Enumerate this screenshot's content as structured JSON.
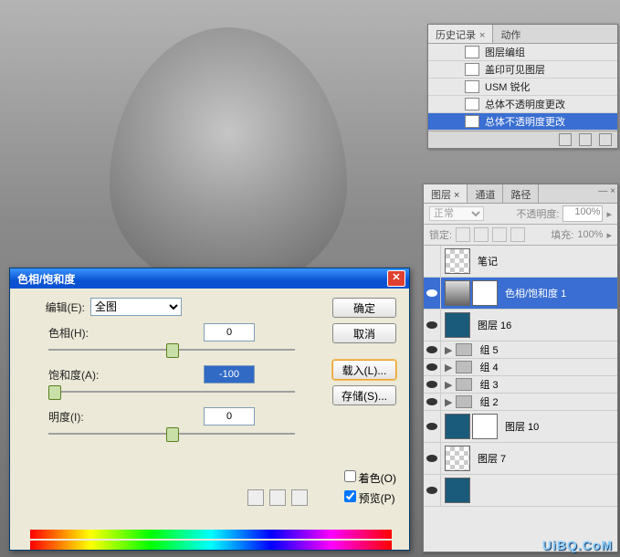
{
  "history": {
    "tabs": {
      "history": "历史记录",
      "actions": "动作"
    },
    "items": [
      {
        "label": "图层编组"
      },
      {
        "label": "盖印可见图层"
      },
      {
        "label": "USM 锐化"
      },
      {
        "label": "总体不透明度更改"
      },
      {
        "label": "总体不透明度更改",
        "selected": true
      }
    ]
  },
  "layers": {
    "tabs": {
      "layers": "图层",
      "channels": "通道",
      "paths": "路径"
    },
    "blend_mode": "正常",
    "opacity_label": "不透明度:",
    "opacity_value": "100%",
    "lock_label": "锁定:",
    "fill_label": "填充:",
    "fill_value": "100%",
    "items": [
      {
        "name": "笔记",
        "thumb": "checker",
        "visible": false
      },
      {
        "name": "色相/饱和度 1",
        "thumb": "grad",
        "mask": true,
        "selected": true,
        "visible": true
      },
      {
        "name": "图层 16",
        "thumb": "blue",
        "visible": true
      },
      {
        "name": "组 5",
        "type": "group",
        "visible": true
      },
      {
        "name": "组 4",
        "type": "group",
        "visible": true
      },
      {
        "name": "组 3",
        "type": "group",
        "visible": true
      },
      {
        "name": "组 2",
        "type": "group",
        "visible": true
      },
      {
        "name": "图层 10",
        "thumb": "figure",
        "mask": true,
        "visible": true
      },
      {
        "name": "图层 7",
        "thumb": "checker",
        "visible": true
      },
      {
        "name": "",
        "thumb": "blue",
        "visible": true
      }
    ]
  },
  "dialog": {
    "title": "色相/饱和度",
    "edit_label": "编辑(E):",
    "edit_value": "全图",
    "hue_label": "色相(H):",
    "hue_value": "0",
    "sat_label": "饱和度(A):",
    "sat_value": "-100",
    "light_label": "明度(I):",
    "light_value": "0",
    "ok": "确定",
    "cancel": "取消",
    "load": "载入(L)...",
    "save": "存储(S)...",
    "colorize": "着色(O)",
    "preview": "预览(P)"
  },
  "watermark": "UiBQ.CoM"
}
